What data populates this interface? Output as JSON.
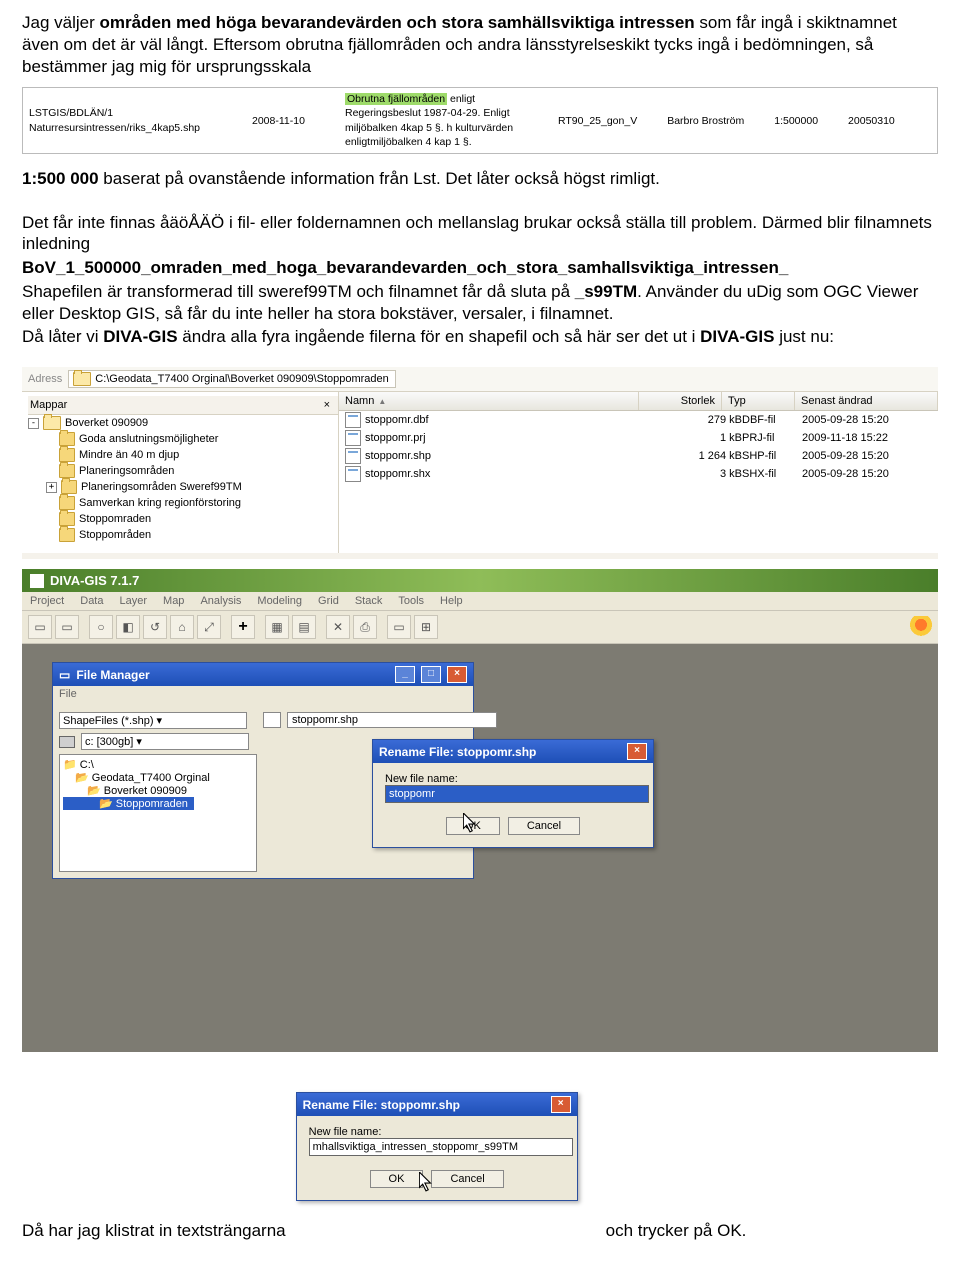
{
  "para1": {
    "t1": "Jag väljer ",
    "t2": "områden med höga bevarandevärden och stora samhällsviktiga intressen",
    "t3": " som får ingå i skiktnamnet även om det är väl långt. Eftersom obrutna fjällområden och andra länsstyrelseskikt tycks ingå i bedömningen, så bestämmer jag mig för ursprungsskala"
  },
  "meta": {
    "left_line1": "LSTGIS/BDLÄN/1",
    "left_line2": "Naturresursintressen/riks_4kap5.shp",
    "date": "2008-11-10",
    "desc_hilite": "Obrutna fjällområden",
    "desc_rest1": " enligt",
    "desc_rest2": "Regeringsbeslut 1987-04-29. Enligt miljöbalken 4kap 5 §. h kulturvärden enligtmiljöbalken 4 kap 1 §.",
    "crs": "RT90_25_gon_V",
    "author": "Barbro Broström",
    "scale": "1:500000",
    "code": "20050310"
  },
  "para2": {
    "t1": "1:500 000",
    "t2": " baserat på ovanstående information från Lst. Det låter också högst rimligt."
  },
  "para3": "Det får inte finnas åäöÅÄÖ i fil- eller foldernamnen och mellanslag brukar också ställa till problem. Därmed blir filnamnets inledning",
  "para4_bold": "BoV_1_500000_omraden_med_hoga_bevarandevarden_och_stora_samhallsviktiga_intressen_",
  "para5": {
    "t1": "Shapefilen är transformerad till sweref99TM och filnamnet får då sluta på ",
    "t2": "_s99TM",
    "t3": ". Använder du uDig som OGC Viewer eller Desktop GIS, så får du inte heller ha stora bokstäver, versaler, i filnamnet."
  },
  "para6": {
    "t1": "Då låter vi ",
    "t2": "DIVA-GIS",
    "t3": " ändra alla fyra ingående filerna för en shapefil och så här ser det ut i ",
    "t4": "DIVA-GIS",
    "t5": " just nu:"
  },
  "explorer": {
    "addr_label": "Adress",
    "addr_path": "C:\\Geodata_T7400 Orginal\\Boverket 090909\\Stoppomraden",
    "tree_header": "Mappar",
    "tree": [
      "Boverket 090909",
      "Goda anslutningsmöjligheter",
      "Mindre än 40 m djup",
      "Planeringsområden",
      "Planeringsområden Sweref99TM",
      "Samverkan kring regionförstoring",
      "Stoppomraden",
      "Stoppområden"
    ],
    "cols": {
      "name": "Namn",
      "size": "Storlek",
      "type": "Typ",
      "mod": "Senast ändrad"
    },
    "files": [
      {
        "name": "stoppomr.dbf",
        "size": "279 kB",
        "type": "DBF-fil",
        "mod": "2005-09-28 15:20"
      },
      {
        "name": "stoppomr.prj",
        "size": "1 kB",
        "type": "PRJ-fil",
        "mod": "2009-11-18 15:22"
      },
      {
        "name": "stoppomr.shp",
        "size": "1 264 kB",
        "type": "SHP-fil",
        "mod": "2005-09-28 15:20"
      },
      {
        "name": "stoppomr.shx",
        "size": "3 kB",
        "type": "SHX-fil",
        "mod": "2005-09-28 15:20"
      }
    ]
  },
  "diva": {
    "title": "DIVA-GIS 7.1.7",
    "menus": [
      "Project",
      "Data",
      "Layer",
      "Map",
      "Analysis",
      "Modeling",
      "Grid",
      "Stack",
      "Tools",
      "Help"
    ],
    "fm": {
      "title": "File Manager",
      "menu": "File",
      "filter": "ShapeFiles (*.shp)",
      "drive": "c: [300gb]",
      "current_file": "stoppomr.shp",
      "tree": [
        "C:\\",
        "Geodata_T7400 Orginal",
        "Boverket 090909",
        "Stoppomraden"
      ]
    },
    "rename": {
      "title": "Rename File: stoppomr.shp",
      "label": "New file name:",
      "value1": "stoppomr",
      "value2": "mhallsviktiga_intressen_stoppomr_s99TM",
      "ok": "OK",
      "cancel": "Cancel"
    }
  },
  "last": {
    "t1": "Då har jag klistrat in textsträngarna",
    "t2": "och trycker på OK."
  }
}
